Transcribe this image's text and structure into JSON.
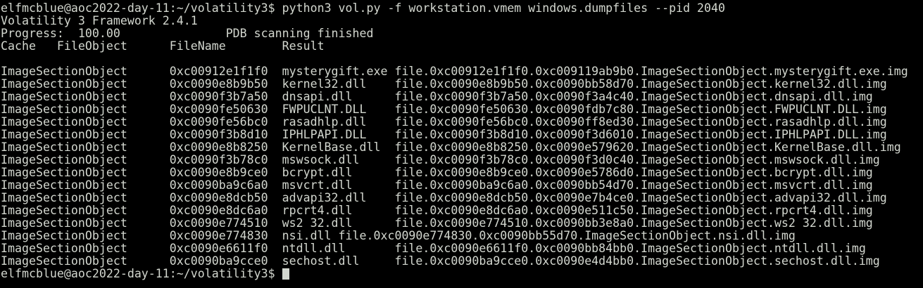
{
  "terminal": {
    "prompt": "elfmcblue@aoc2022-day-11:~/volatility3$",
    "command": "python3 vol.py -f workstation.vmem windows.dumpfiles --pid 2040",
    "output": [
      "Volatility 3 Framework 2.4.1",
      "Progress:  100.00               PDB scanning finished",
      "Cache   FileObject      FileName        Result",
      "",
      "ImageSectionObject      0xc00912e1f1f0  mysterygift.exe file.0xc00912e1f1f0.0xc009119ab9b0.ImageSectionObject.mysterygift.exe.img",
      "ImageSectionObject      0xc0090e8b9b50  kernel32.dll    file.0xc0090e8b9b50.0xc0090bb58d70.ImageSectionObject.kernel32.dll.img",
      "ImageSectionObject      0xc0090f3b7a50  dnsapi.dll      file.0xc0090f3b7a50.0xc0090f3a4c40.ImageSectionObject.dnsapi.dll.img",
      "ImageSectionObject      0xc0090fe50630  FWPUCLNT.DLL    file.0xc0090fe50630.0xc0090fdb7c80.ImageSectionObject.FWPUCLNT.DLL.img",
      "ImageSectionObject      0xc0090fe56bc0  rasadhlp.dll    file.0xc0090fe56bc0.0xc0090ff8ed30.ImageSectionObject.rasadhlp.dll.img",
      "ImageSectionObject      0xc0090f3b8d10  IPHLPAPI.DLL    file.0xc0090f3b8d10.0xc0090f3d6010.ImageSectionObject.IPHLPAPI.DLL.img",
      "ImageSectionObject      0xc0090e8b8250  KernelBase.dll  file.0xc0090e8b8250.0xc0090e579620.ImageSectionObject.KernelBase.dll.img",
      "ImageSectionObject      0xc0090f3b78c0  mswsock.dll     file.0xc0090f3b78c0.0xc0090f3d0c40.ImageSectionObject.mswsock.dll.img",
      "ImageSectionObject      0xc0090e8b9ce0  bcrypt.dll      file.0xc0090e8b9ce0.0xc0090e5786d0.ImageSectionObject.bcrypt.dll.img",
      "ImageSectionObject      0xc0090ba9c6a0  msvcrt.dll      file.0xc0090ba9c6a0.0xc0090bb54d70.ImageSectionObject.msvcrt.dll.img",
      "ImageSectionObject      0xc0090e8dcb50  advapi32.dll    file.0xc0090e8dcb50.0xc0090e7b4ce0.ImageSectionObject.advapi32.dll.img",
      "ImageSectionObject      0xc0090e8dc6a0  rpcrt4.dll      file.0xc0090e8dc6a0.0xc0090e511c50.ImageSectionObject.rpcrt4.dll.img",
      "ImageSectionObject      0xc0090e774510  ws2 32.dll      file.0xc0090e774510.0xc0090bb3e8a0.ImageSectionObject.ws2 32.dll.img",
      "ImageSectionObject      0xc0090e774830  nsi.dll file.0xc0090e774830.0xc0090bb55d70.ImageSectionObject.nsi.dll.img",
      "ImageSectionObject      0xc0090e6611f0  ntdll.dll       file.0xc0090e6611f0.0xc0090bb84bb0.ImageSectionObject.ntdll.dll.img",
      "ImageSectionObject      0xc0090ba9cce0  sechost.dll     file.0xc0090ba9cce0.0xc0090e4d4bb0.ImageSectionObject.sechost.dll.img"
    ]
  },
  "colors": {
    "background": "#000000",
    "foreground": "#d3d7cf"
  }
}
